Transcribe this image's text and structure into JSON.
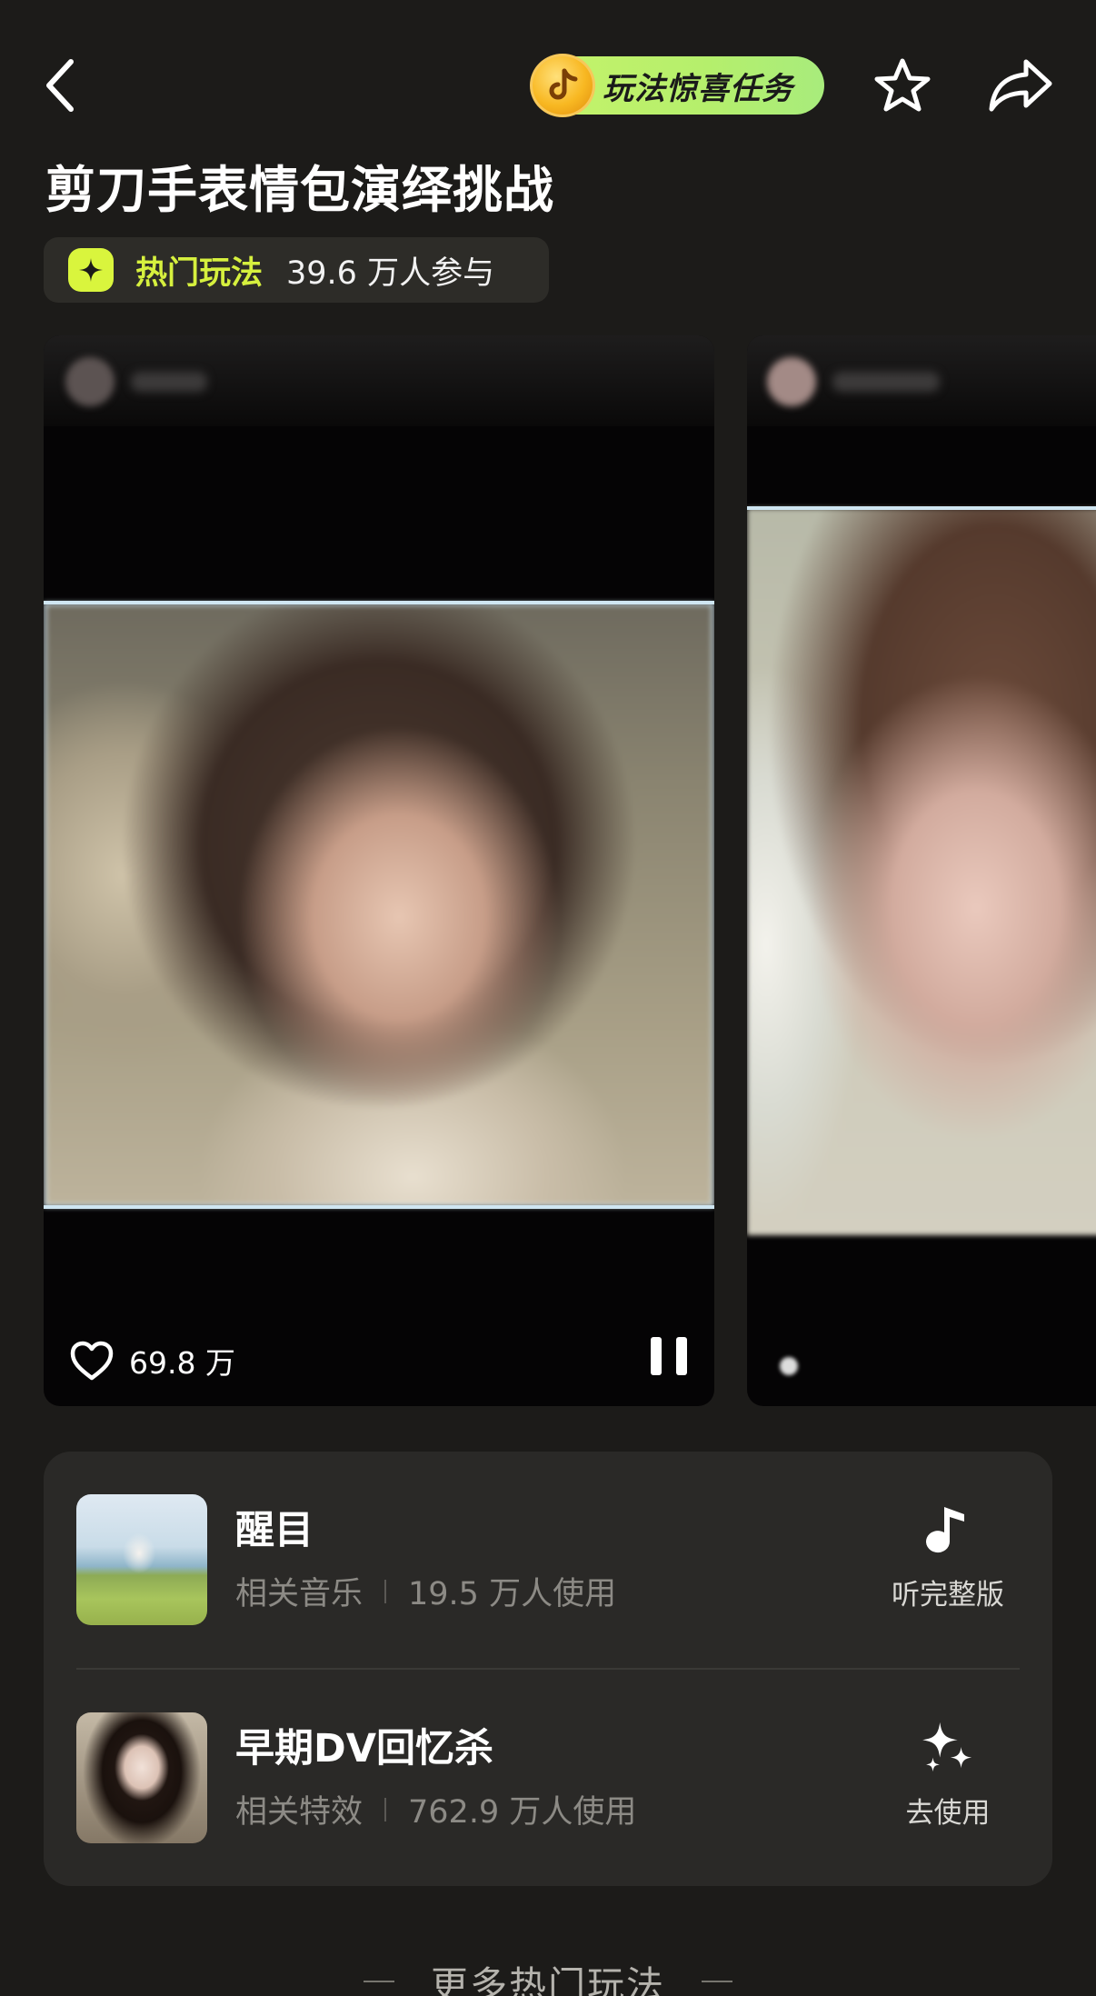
{
  "header": {
    "task_label": "玩法惊喜任务"
  },
  "title": "剪刀手表情包演绎挑战",
  "badge": {
    "label": "热门玩法",
    "count": "39.6 万人参与"
  },
  "video_cards": [
    {
      "likes": "69.8 万",
      "state": "playing"
    },
    {
      "likes": ""
    }
  ],
  "related": [
    {
      "name": "醒目",
      "type": "相关音乐",
      "usage": "19.5 万人使用",
      "action": "听完整版",
      "action_icon": "music-note-icon"
    },
    {
      "name": "早期DV回忆杀",
      "type": "相关特效",
      "usage": "762.9 万人使用",
      "action": "去使用",
      "action_icon": "sparkle-icon"
    }
  ],
  "more_label": "更多热门玩法",
  "colors": {
    "background": "#1c1b19",
    "accent": "#d6f03e",
    "pill": "#c6f36a",
    "panel": "#2a2927"
  }
}
